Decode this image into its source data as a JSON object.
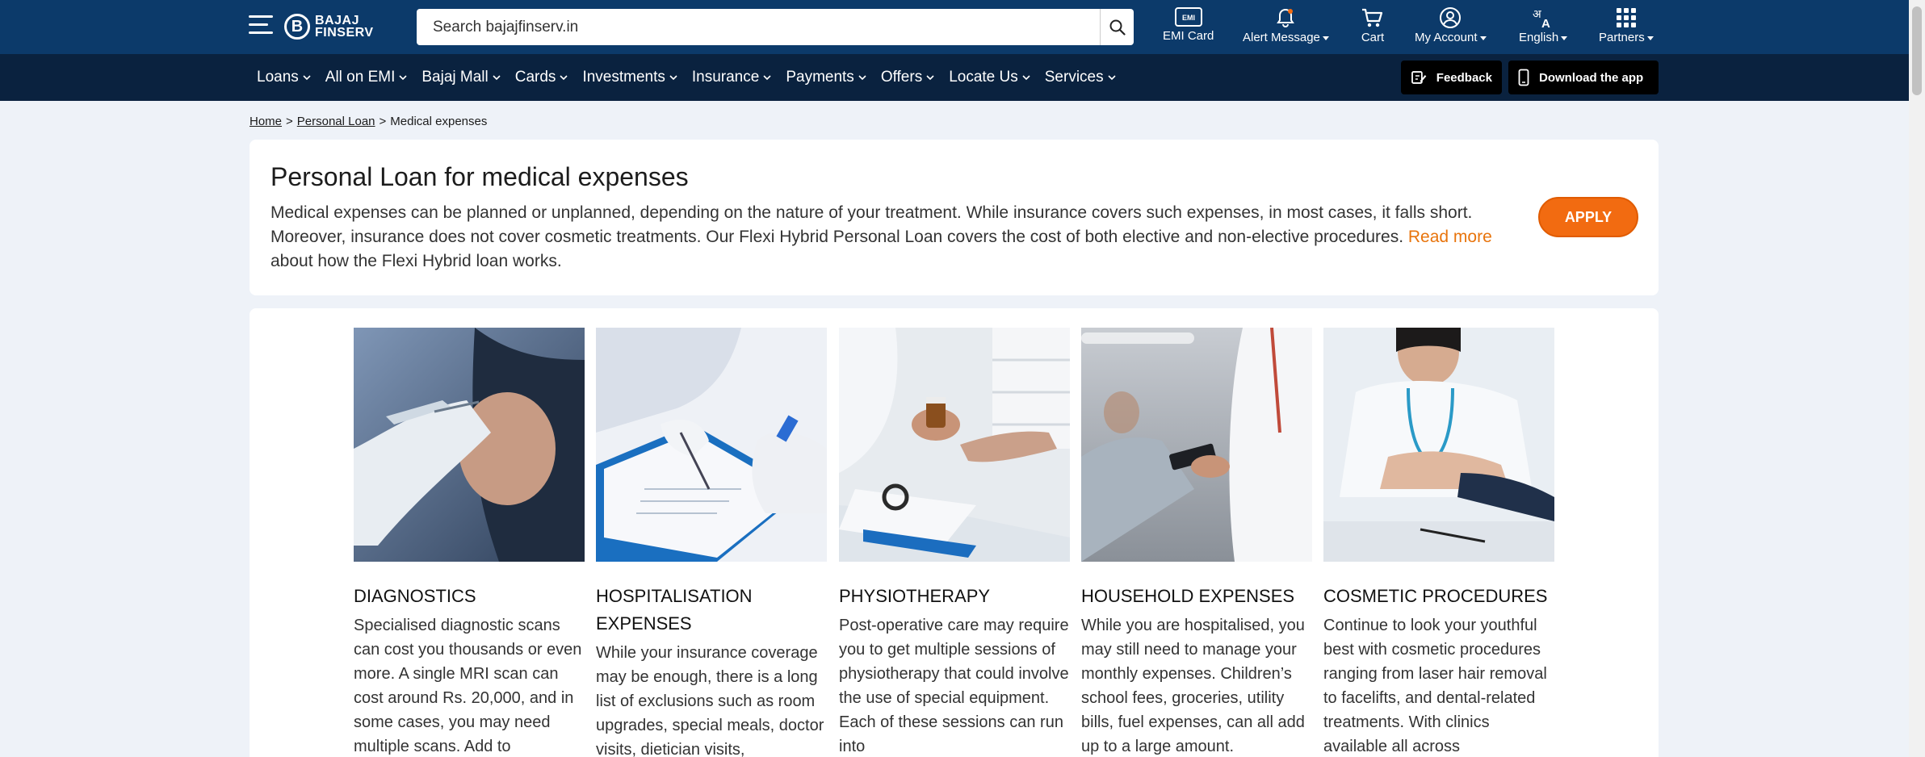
{
  "header": {
    "brand_top": "BAJAJ",
    "brand_bottom": "FINSERV",
    "search_placeholder": "Search bajajfinserv.in",
    "items": [
      {
        "label": "EMI Card",
        "icon": "emi-card-icon"
      },
      {
        "label": "Alert Message",
        "icon": "bell-icon"
      },
      {
        "label": "Cart",
        "icon": "cart-icon"
      },
      {
        "label": "My Account",
        "icon": "account-icon"
      },
      {
        "label": "English",
        "icon": "language-icon"
      },
      {
        "label": "Partners",
        "icon": "grid-icon"
      }
    ],
    "emi_badge": "EMI"
  },
  "nav": {
    "items": [
      "Loans",
      "All on EMI",
      "Bajaj Mall",
      "Cards",
      "Investments",
      "Insurance",
      "Payments",
      "Offers",
      "Locate Us",
      "Services"
    ],
    "feedback_label": "Feedback",
    "download_label": "Download the app"
  },
  "breadcrumb": {
    "home": "Home",
    "personal_loan": "Personal Loan",
    "current": "Medical expenses",
    "separator": ">"
  },
  "intro": {
    "title": "Personal Loan for medical expenses",
    "body": "Medical expenses can be planned or unplanned, depending on the nature of your treatment. While insurance covers such expenses, in most cases, it falls short. Moreover, insurance does not cover cosmetic treatments. Our Flexi Hybrid Personal Loan covers the cost of both elective and non-elective procedures. ",
    "link_text": "Read more",
    "body_tail": " about how the Flexi Hybrid loan works.",
    "apply_label": "APPLY"
  },
  "cards": [
    {
      "title": "DIAGNOSTICS",
      "text": "Specialised diagnostic scans can cost you thousands or even more. A single MRI scan can cost around Rs. 20,000, and in some cases, you may need multiple scans. Add to"
    },
    {
      "title": "HOSPITALISATION EXPENSES",
      "text": "While your insurance coverage may be enough, there is a long list of exclusions such as room upgrades, special meals, doctor visits, dietician visits,"
    },
    {
      "title": "PHYSIOTHERAPY",
      "text": "Post-operative care may require you to get multiple sessions of physiotherapy that could involve the use of special equipment. Each of these sessions can run into"
    },
    {
      "title": "HOUSEHOLD EXPENSES",
      "text": "While you are hospitalised, you may still need to manage your monthly expenses. Children’s school fees, groceries, utility bills, fuel expenses, can all add up to a large amount."
    },
    {
      "title": "COSMETIC PROCEDURES",
      "text": "Continue to look your youthful best with cosmetic procedures ranging from laser hair removal to facelifts, and dental-related treatments. With clinics available all across"
    }
  ],
  "colors": {
    "header_bg": "#0c3a6a",
    "nav_bg": "#0a223f",
    "accent": "#f26b11",
    "link": "#e8740c"
  }
}
